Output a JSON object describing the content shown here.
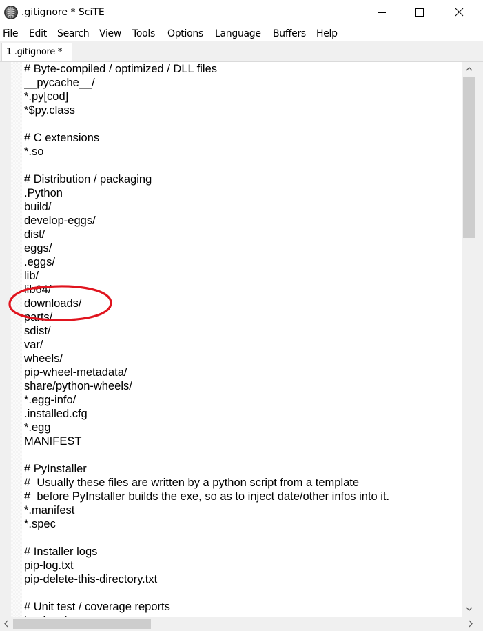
{
  "window": {
    "title": ".gitignore * SciTE",
    "app_icon": "scite-app-icon",
    "controls": [
      "minimize-icon",
      "maximize-icon",
      "close-icon"
    ]
  },
  "menu": {
    "items": [
      "File",
      "Edit",
      "Search",
      "View",
      "Tools",
      "Options",
      "Language",
      "Buffers",
      "Help"
    ]
  },
  "tabs": [
    {
      "label": "1 .gitignore *"
    }
  ],
  "editor": {
    "lines": [
      "# Byte-compiled / optimized / DLL files",
      "__pycache__/",
      "*.py[cod]",
      "*$py.class",
      "",
      "# C extensions",
      "*.so",
      "",
      "# Distribution / packaging",
      ".Python",
      "build/",
      "develop-eggs/",
      "dist/",
      "eggs/",
      ".eggs/",
      "lib/",
      "lib64/",
      "downloads/",
      "parts/",
      "sdist/",
      "var/",
      "wheels/",
      "pip-wheel-metadata/",
      "share/python-wheels/",
      "*.egg-info/",
      ".installed.cfg",
      "*.egg",
      "MANIFEST",
      "",
      "# PyInstaller",
      "#  Usually these files are written by a python script from a template",
      "#  before PyInstaller builds the exe, so as to inject date/other infos into it.",
      "*.manifest",
      "*.spec",
      "",
      "# Installer logs",
      "pip-log.txt",
      "pip-delete-this-directory.txt",
      "",
      "# Unit test / coverage reports",
      "htmlcov/"
    ],
    "highlighted_line": "downloads/",
    "highlight_color": "#e0141e"
  },
  "scrollbars": {
    "vertical_position": 0,
    "horizontal_position": 0
  }
}
